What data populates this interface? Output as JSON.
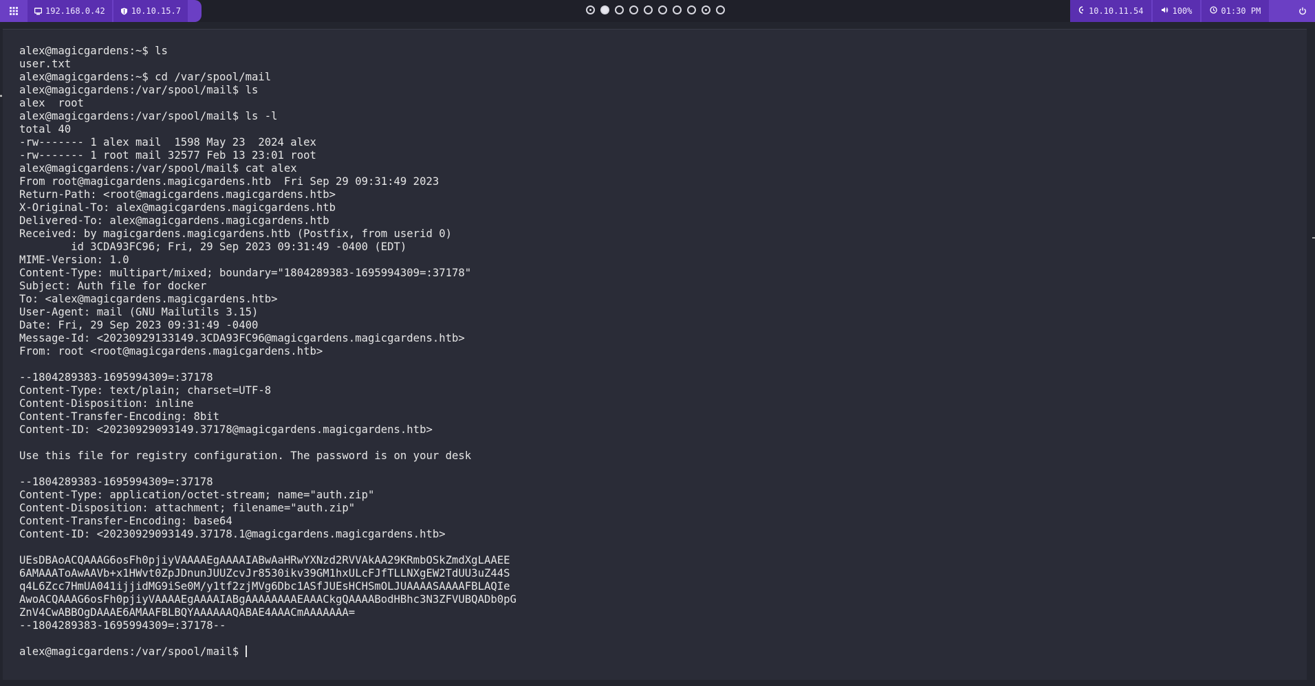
{
  "topbar": {
    "left_items": [
      {
        "icon": "display-icon",
        "label": "192.168.0.42"
      },
      {
        "icon": "shield-icon",
        "label": "10.10.15.7"
      }
    ],
    "workspaces": [
      {
        "state": "ring"
      },
      {
        "state": "active"
      },
      {
        "state": "empty"
      },
      {
        "state": "empty"
      },
      {
        "state": "empty"
      },
      {
        "state": "empty"
      },
      {
        "state": "empty"
      },
      {
        "state": "empty"
      },
      {
        "state": "ring"
      },
      {
        "state": "empty"
      }
    ],
    "right_items": [
      {
        "icon": "target-icon",
        "label": "10.10.11.54"
      },
      {
        "icon": "volume-icon",
        "label": "100%"
      },
      {
        "icon": "clock-icon",
        "label": "01:30 PM"
      }
    ],
    "accent": "#6b3fc4"
  },
  "terminal": {
    "lines": [
      "alex@magicgardens:~$ ls",
      "user.txt",
      "alex@magicgardens:~$ cd /var/spool/mail",
      "alex@magicgardens:/var/spool/mail$ ls",
      "alex  root",
      "alex@magicgardens:/var/spool/mail$ ls -l",
      "total 40",
      "-rw------- 1 alex mail  1598 May 23  2024 alex",
      "-rw------- 1 root mail 32577 Feb 13 23:01 root",
      "alex@magicgardens:/var/spool/mail$ cat alex",
      "From root@magicgardens.magicgardens.htb  Fri Sep 29 09:31:49 2023",
      "Return-Path: <root@magicgardens.magicgardens.htb>",
      "X-Original-To: alex@magicgardens.magicgardens.htb",
      "Delivered-To: alex@magicgardens.magicgardens.htb",
      "Received: by magicgardens.magicgardens.htb (Postfix, from userid 0)",
      "        id 3CDA93FC96; Fri, 29 Sep 2023 09:31:49 -0400 (EDT)",
      "MIME-Version: 1.0",
      "Content-Type: multipart/mixed; boundary=\"1804289383-1695994309=:37178\"",
      "Subject: Auth file for docker",
      "To: <alex@magicgardens.magicgardens.htb>",
      "User-Agent: mail (GNU Mailutils 3.15)",
      "Date: Fri, 29 Sep 2023 09:31:49 -0400",
      "Message-Id: <20230929133149.3CDA93FC96@magicgardens.magicgardens.htb>",
      "From: root <root@magicgardens.magicgardens.htb>",
      "",
      "--1804289383-1695994309=:37178",
      "Content-Type: text/plain; charset=UTF-8",
      "Content-Disposition: inline",
      "Content-Transfer-Encoding: 8bit",
      "Content-ID: <20230929093149.37178@magicgardens.magicgardens.htb>",
      "",
      "Use this file for registry configuration. The password is on your desk",
      "",
      "--1804289383-1695994309=:37178",
      "Content-Type: application/octet-stream; name=\"auth.zip\"",
      "Content-Disposition: attachment; filename=\"auth.zip\"",
      "Content-Transfer-Encoding: base64",
      "Content-ID: <20230929093149.37178.1@magicgardens.magicgardens.htb>",
      "",
      "UEsDBAoACQAAAG6osFh0pjiyVAAAAEgAAAAIABwAaHRwYXNzd2RVVAkAA29KRmbOSkZmdXgLAAEE",
      "6AMAAAToAwAAVb+x1HWvt0ZpJDnunJUUZcvJr8530ikv39GM1hxULcFJfTLLNXgEW2TdUU3uZ44S",
      "q4L6Zcc7HmUA041ijjidMG9iSe0M/y1tf2zjMVg6Dbc1ASfJUEsHCHSmOLJUAAAASAAAAFBLAQIe",
      "AwoACQAAAG6osFh0pjiyVAAAAEgAAAAIABgAAAAAAAAEAAACkgQAAAABodHBhc3N3ZFVUBQADb0pG",
      "ZnV4CwABBOgDAAAE6AMAAFBLBQYAAAAAAQABAE4AAACmAAAAAAA=",
      "--1804289383-1695994309=:37178--",
      ""
    ],
    "prompt": "alex@magicgardens:/var/spool/mail$ "
  }
}
